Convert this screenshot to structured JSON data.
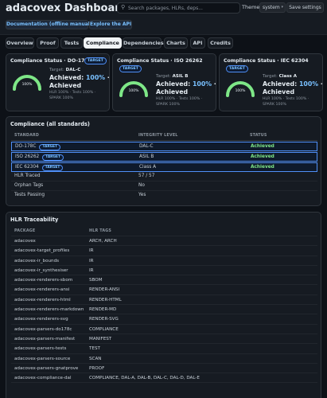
{
  "header": {
    "title": "adacovex Dashboard",
    "search_placeholder": "Search packages, HLRs, deps...",
    "search_icon": "search-icon",
    "theme_label": "Theme",
    "theme_value": "system",
    "save_label": "Save settings",
    "doc_link": "Documentation (offline manual)",
    "api_link": "Explore the API"
  },
  "tabs": [
    "Overview",
    "Proof",
    "Tests",
    "Compliance",
    "Dependencies",
    "Charts",
    "API",
    "Credits"
  ],
  "active_tab": "Compliance",
  "cards": [
    {
      "title": "Compliance Status · DO-178C",
      "badge": "TARGET",
      "target_label": "Target:",
      "target_value": "DAL-C",
      "gauge_pct": "100%",
      "achieved_prefix": "Achieved:",
      "achieved_pct": "100%",
      "achieved_sep": "·",
      "achieved_word": "Achieved",
      "meta1": "HLR 100% · Tests 100% ·",
      "meta2": "SPARK 100%"
    },
    {
      "title": "Compliance Status · ISO 26262",
      "badge": "TARGET",
      "target_label": "Target:",
      "target_value": "ASIL B",
      "gauge_pct": "100%",
      "achieved_prefix": "Achieved:",
      "achieved_pct": "100%",
      "achieved_sep": "·",
      "achieved_word": "Achieved",
      "meta1": "HLR 100% · Tests 100% ·",
      "meta2": "SPARK 100%"
    },
    {
      "title": "Compliance Status · IEC 62304",
      "badge": "TARGET",
      "target_label": "Target:",
      "target_value": "Class A",
      "gauge_pct": "100%",
      "achieved_prefix": "Achieved:",
      "achieved_pct": "100%",
      "achieved_sep": "·",
      "achieved_word": "Achieved",
      "meta1": "HLR 100% · Tests 100% ·",
      "meta2": "SPARK 100%"
    }
  ],
  "compliance": {
    "title": "Compliance (all standards)",
    "columns": [
      "STANDARD",
      "INTEGRITY LEVEL",
      "STATUS"
    ],
    "rows": [
      {
        "standard": "DO-178C",
        "badge": "TARGET",
        "level": "DAL-C",
        "status": "Achieved"
      },
      {
        "standard": "ISO 26262",
        "badge": "TARGET",
        "level": "ASIL B",
        "status": "Achieved"
      },
      {
        "standard": "IEC 62304",
        "badge": "TARGET",
        "level": "Class A",
        "status": "Achieved"
      }
    ],
    "extra": [
      {
        "label": "HLR Traced",
        "value": "57 / 57"
      },
      {
        "label": "Orphan Tags",
        "value": "No"
      },
      {
        "label": "Tests Passing",
        "value": "Yes"
      }
    ]
  },
  "traceability": {
    "title": "HLR Traceability",
    "columns": [
      "PACKAGE",
      "HLR TAGS"
    ],
    "rows": [
      {
        "package": "adacovex",
        "tags": "ARCH, ARCH"
      },
      {
        "package": "adacovex-target_profiles",
        "tags": "IR"
      },
      {
        "package": "adacovex-ir_bounds",
        "tags": "IR"
      },
      {
        "package": "adacovex-ir_synthesiser",
        "tags": "IR"
      },
      {
        "package": "adacovex-renderers-sbom",
        "tags": "SBOM"
      },
      {
        "package": "adacovex-renderers-ansi",
        "tags": "RENDER-ANSI"
      },
      {
        "package": "adacovex-renderers-html",
        "tags": "RENDER-HTML"
      },
      {
        "package": "adacovex-renderers-markdown",
        "tags": "RENDER-MD"
      },
      {
        "package": "adacovex-renderers-svg",
        "tags": "RENDER-SVG"
      },
      {
        "package": "adacovex-parsers-do178c",
        "tags": "COMPLIANCE"
      },
      {
        "package": "adacovex-parsers-manifest",
        "tags": "MANIFEST"
      },
      {
        "package": "adacovex-parsers-tests",
        "tags": "TEST"
      },
      {
        "package": "adacovex-parsers-source",
        "tags": "SCAN"
      },
      {
        "package": "adacovex-parsers-gnatprove",
        "tags": "PROOF"
      },
      {
        "package": "adacovex-compliance-dal",
        "tags": "COMPLIANCE, DAL-A, DAL-B, DAL-C, DAL-D, DAL-E"
      }
    ]
  },
  "colors": {
    "accent": "#79c0ff",
    "achieved": "#7ee787",
    "gauge": "#7ee787"
  }
}
